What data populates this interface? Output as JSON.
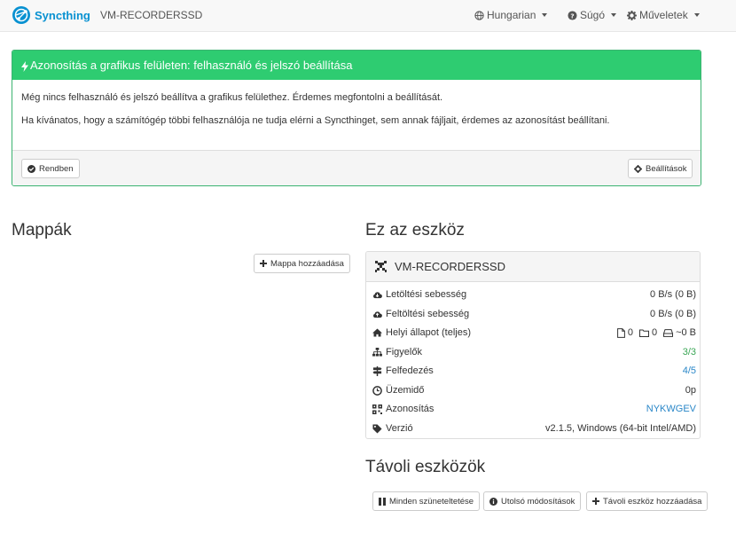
{
  "navbar": {
    "brand": "Syncthing",
    "device_name": "VM-RECORDERSSD",
    "language": "Hungarian",
    "help": "Súgó",
    "actions": "Műveletek"
  },
  "notice": {
    "title": "Azonosítás a grafikus felületen: felhasználó és jelszó beállítása",
    "line1": "Még nincs felhasználó és jelszó beállítva a grafikus felülethez. Érdemes megfontolni a beállítását.",
    "line2": "Ha kívánatos, hogy a számítógép többi felhasználója ne tudja elérni a Syncthinget, sem annak fájljait, érdemes az azonosítást beállítani.",
    "ok_button": "Rendben",
    "settings_button": "Beállítások"
  },
  "folders": {
    "title": "Mappák",
    "add_button": "Mappa hozzáadása"
  },
  "this_device": {
    "title": "Ez az eszköz",
    "name": "VM-RECORDERSSD",
    "rows": [
      {
        "label": "Letöltési sebesség",
        "value": "0 B/s (0 B)",
        "icon": "cloud-download-icon"
      },
      {
        "label": "Feltöltési sebesség",
        "value": "0 B/s (0 B)",
        "icon": "cloud-upload-icon"
      },
      {
        "label": "Helyi állapot (teljes)",
        "value": "",
        "icon": "home-icon"
      },
      {
        "label": "Figyelők",
        "value": "3/3",
        "icon": "sitemap-icon"
      },
      {
        "label": "Felfedezés",
        "value": "4/5",
        "icon": "signpost-icon"
      },
      {
        "label": "Üzemidő",
        "value": "0p",
        "icon": "clock-icon"
      },
      {
        "label": "Azonosítás",
        "value": "NYKWGEV",
        "icon": "qrcode-icon"
      },
      {
        "label": "Verzió",
        "value": "v2.1.5, Windows (64-bit Intel/AMD)",
        "icon": "tag-icon"
      }
    ],
    "local_state": {
      "files": "0",
      "folders": "0",
      "size": "~0 B"
    }
  },
  "remote_devices": {
    "title": "Távoli eszközök",
    "pause_all": "Minden szüneteltetése",
    "recent_changes": "Utolsó módosítások",
    "add_remote": "Távoli eszköz hozzáadása"
  },
  "colors": {
    "brand": "#0891d1",
    "notice_green": "#2ecc71",
    "link_blue": "#2a87c8",
    "ok_green": "#3aa655"
  }
}
